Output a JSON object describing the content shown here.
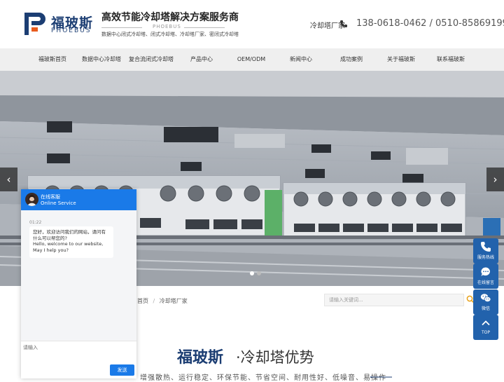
{
  "header": {
    "logo_cn": "福玻斯",
    "logo_en": "PHOEBUS",
    "slogan": "高效节能冷却塔解决方案服务商",
    "slogan_en": "PHOEBUS",
    "keywords": "数据中心闭式冷却塔、闭式冷却塔、冷却塔厂家、密闭式冷却塔",
    "right_label": "冷却塔厂家",
    "hotline": "138-0618-0462 / 0510-85869199",
    "brand_color": "#1c3e73"
  },
  "nav": {
    "items": [
      "福玻斯首页",
      "数据中心冷却塔",
      "复合流闭式冷却塔",
      "产品中心",
      "OEM/ODM",
      "新闻中心",
      "成功案例",
      "关于福玻斯",
      "联系福玻斯"
    ]
  },
  "hero": {
    "prev_icon": "chevron-left-icon",
    "next_icon": "chevron-right-icon",
    "slides": 2
  },
  "breadcrumb": {
    "parent": "首页",
    "current": "冷却塔厂家",
    "separator": "/"
  },
  "search": {
    "placeholder": "请输入关键词..."
  },
  "advantage": {
    "brand": "福玻斯",
    "title": "·冷却塔优势",
    "desc": "增强散热、运行稳定、环保节能、节省空间、耐用性好、低噪音、易操作"
  },
  "sidebar": {
    "items": [
      {
        "label": "服务热线",
        "icon": "phone-icon"
      },
      {
        "label": "在线留言",
        "icon": "message-icon"
      },
      {
        "label": "微信",
        "icon": "wechat-icon"
      },
      {
        "label": "TOP",
        "icon": "arrow-up-icon"
      }
    ],
    "color": "#2262ac"
  },
  "chat": {
    "title": "在线客服",
    "subtitle": "Online Service",
    "time": "01:22",
    "message_cn": "您好，欢迎访问我们的网站，请问有什么可以帮您的?",
    "message_en": "Hello, welcome to our website, May I help you?",
    "input_placeholder": "请输入",
    "send_label": "发送",
    "color": "#1a7ae8"
  }
}
